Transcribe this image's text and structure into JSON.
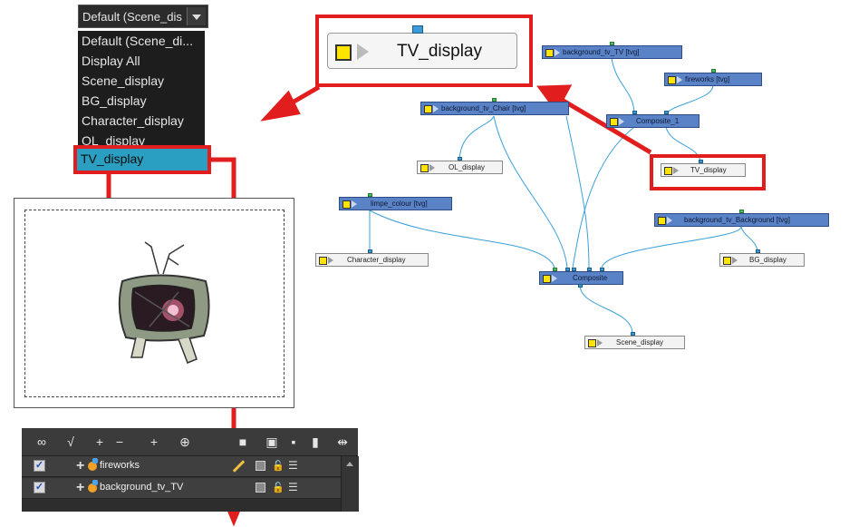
{
  "dropdown": {
    "current": "Default (Scene_dis",
    "options": [
      "Default (Scene_di...",
      "Display All",
      "Scene_display",
      "BG_display",
      "Character_display",
      "OL_display"
    ],
    "selected": "TV_display"
  },
  "big_node": {
    "label": "TV_display"
  },
  "nodes": {
    "bg_tv_tv": "background_tv_TV [tvg]",
    "fireworks": "fireworks [tvg]",
    "composite_1": "Composite_1",
    "tv_display": "TV_display",
    "bg_tv_chair": "background_tv_Chair [tvg]",
    "ol_display": "OL_display",
    "limpe_colour": "limpe_colour [tvg]",
    "bg_tv_background": "background_tv_Background [tvg]",
    "character_display": "Character_display",
    "bg_display": "BG_display",
    "composite": "Composite",
    "scene_display": "Scene_display"
  },
  "timeline": {
    "layers": [
      {
        "name": "fireworks",
        "checked": "✓"
      },
      {
        "name": "background_tv_TV",
        "checked": "✓"
      }
    ]
  },
  "colors": {
    "highlight_red": "#e11d1d",
    "selection_blue": "#2a9fc1",
    "node_blue": "#5a82c6"
  }
}
